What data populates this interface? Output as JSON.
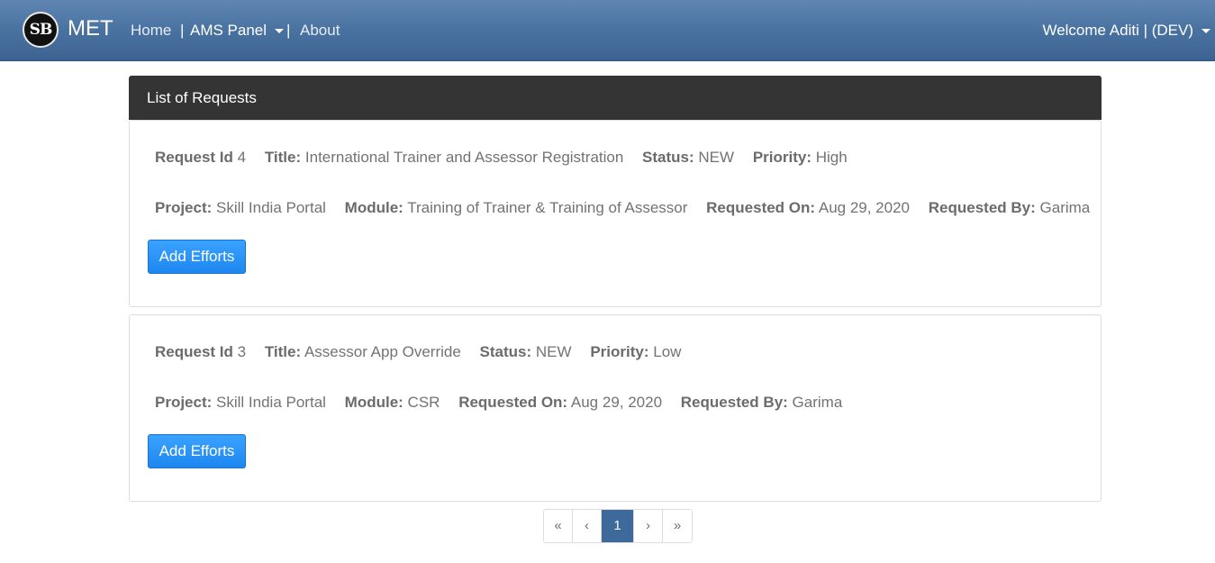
{
  "navbar": {
    "logo_text": "SB",
    "brand": "MET",
    "links": {
      "home": "Home",
      "ams_panel": "AMS Panel",
      "about": "About"
    },
    "separator": "|",
    "welcome": "Welcome Aditi | (DEV)",
    "accent_color": "#4a72a0"
  },
  "panel": {
    "title": "List of Requests"
  },
  "labels": {
    "request_id": "Request Id",
    "title": "Title:",
    "status": "Status:",
    "priority": "Priority:",
    "project": "Project:",
    "module": "Module:",
    "requested_on": "Requested On:",
    "requested_by": "Requested By:",
    "add_efforts": "Add Efforts"
  },
  "requests": [
    {
      "id": "4",
      "title": "International Trainer and Assessor Registration",
      "status": "NEW",
      "priority": "High",
      "project": "Skill India Portal",
      "module": "Training of Trainer & Training of Assessor",
      "requested_on": "Aug 29, 2020",
      "requested_by": "Garima"
    },
    {
      "id": "3",
      "title": "Assessor App Override",
      "status": "NEW",
      "priority": "Low",
      "project": "Skill India Portal",
      "module": "CSR",
      "requested_on": "Aug 29, 2020",
      "requested_by": "Garima"
    }
  ],
  "pagination": {
    "first": "«",
    "prev": "‹",
    "current": "1",
    "next": "›",
    "last": "»"
  }
}
